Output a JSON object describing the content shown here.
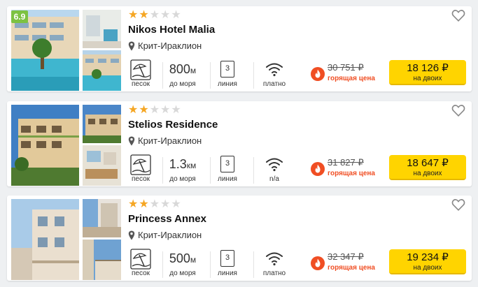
{
  "hotels": [
    {
      "rating": "6.9",
      "stars": 2,
      "name": "Nikos Hotel Malia",
      "location": "Крит-Ираклион",
      "beach_label": "песок",
      "distance_value": "800",
      "distance_unit": "м",
      "distance_label": "до моря",
      "line_value": "3",
      "line_label": "линия",
      "wifi_label": "платно",
      "old_price": "30 751 ₽",
      "hot_label": "горящая цена",
      "price": "18 126 ₽",
      "price_for": "на двоих"
    },
    {
      "rating": "",
      "stars": 2,
      "name": "Stelios Residence",
      "location": "Крит-Ираклион",
      "beach_label": "песок",
      "distance_value": "1.3",
      "distance_unit": "км",
      "distance_label": "до моря",
      "line_value": "3",
      "line_label": "линия",
      "wifi_label": "n/a",
      "old_price": "31 827 ₽",
      "hot_label": "горящая цена",
      "price": "18 647 ₽",
      "price_for": "на двоих"
    },
    {
      "rating": "",
      "stars": 2,
      "name": "Princess Annex",
      "location": "Крит-Ираклион",
      "beach_label": "песок",
      "distance_value": "500",
      "distance_unit": "м",
      "distance_label": "до моря",
      "line_value": "3",
      "line_label": "линия",
      "wifi_label": "платно",
      "old_price": "32 347 ₽",
      "hot_label": "горящая цена",
      "price": "19 234 ₽",
      "price_for": "на двоих"
    }
  ],
  "star_max": 5,
  "colors": {
    "rating_bg": "#7cc242",
    "star_on": "#f5a623",
    "star_off": "#d8d8d8",
    "hot": "#f04e23",
    "price_bg": "#ffd400"
  },
  "icons": {
    "favorite": "heart-outline-icon",
    "location": "map-pin-icon",
    "beach": "beach-umbrella-icon",
    "wifi": "wifi-icon",
    "hot": "flame-icon"
  }
}
